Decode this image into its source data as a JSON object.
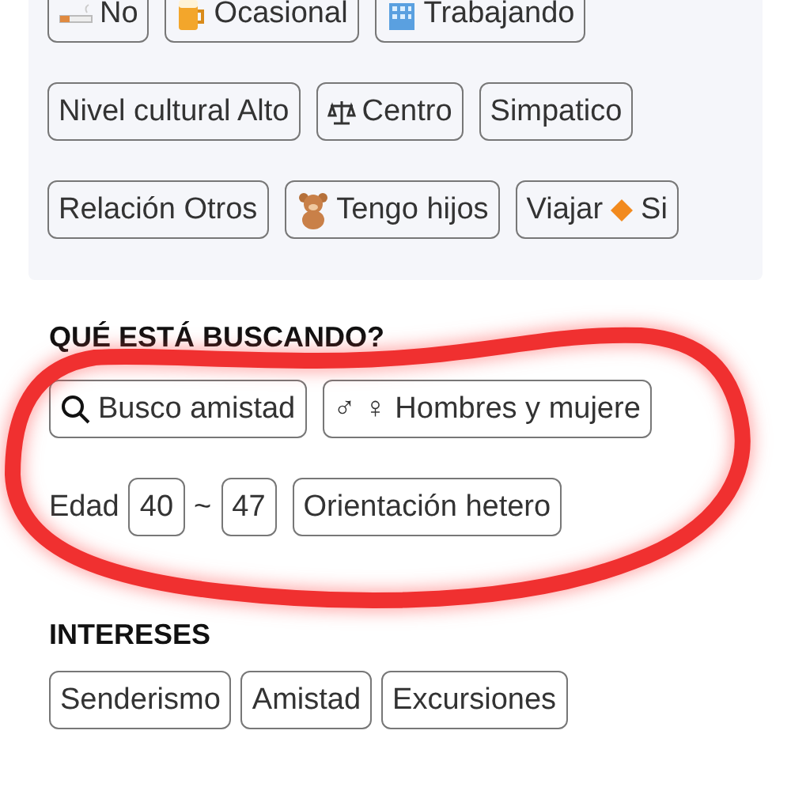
{
  "profile_tags": [
    [
      {
        "label": "No",
        "kind": "cigarette"
      },
      {
        "label": "Ocasional",
        "kind": "beer"
      },
      {
        "label": "Trabajando",
        "kind": "building"
      }
    ],
    [
      {
        "label": "Nivel cultural Alto",
        "kind": "plain"
      },
      {
        "label": "Centro",
        "kind": "scales"
      },
      {
        "label": "Simpatico",
        "kind": "plain"
      }
    ],
    [
      {
        "label": "Relación Otros",
        "kind": "plain"
      },
      {
        "label": "Tengo hijos",
        "kind": "bear"
      },
      {
        "label": "Viajar",
        "kind": "diamond",
        "suffix": "Si"
      }
    ]
  ],
  "looking_for": {
    "heading": "QUÉ ESTÁ BUSCANDO?",
    "tags": [
      {
        "label": "Busco amistad",
        "kind": "search"
      },
      {
        "label": "♂ ♀ Hombres y mujere",
        "kind": "plain"
      }
    ],
    "age_label": "Edad",
    "age_min": "40",
    "age_separator": "~",
    "age_max": "47",
    "orientation": "Orientación hetero"
  },
  "interests": {
    "heading": "INTERESES",
    "tags": [
      "Senderismo",
      "Amistad",
      "Excursiones"
    ]
  },
  "annotation": {
    "kind": "loop"
  }
}
